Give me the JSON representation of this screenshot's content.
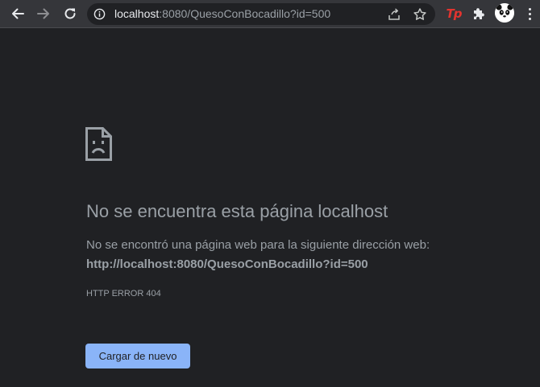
{
  "browser": {
    "url_host": "localhost",
    "url_rest": ":8080/QuesoConBocadillo?id=500",
    "extension_tp_label": "Tp"
  },
  "icons": {
    "back": "arrow-left-icon",
    "forward": "arrow-right-icon",
    "reload": "reload-icon",
    "info": "info-icon",
    "share": "share-icon",
    "bookmark": "star-icon",
    "extensions": "puzzle-icon",
    "profile": "panda-avatar",
    "menu": "kebab-menu-icon",
    "error": "sad-page-icon"
  },
  "colors": {
    "background": "#202124",
    "toolbar": "#35363a",
    "text_secondary": "#9aa0a6",
    "button": "#8ab4f8",
    "extension_red": "#e3342f"
  },
  "error_page": {
    "title": "No se encuentra esta página localhost",
    "description": "No se encontró una página web para la siguiente dirección web:",
    "url": "http://localhost:8080/QuesoConBocadillo?id=500",
    "error_code": "HTTP ERROR 404",
    "reload_label": "Cargar de nuevo"
  }
}
